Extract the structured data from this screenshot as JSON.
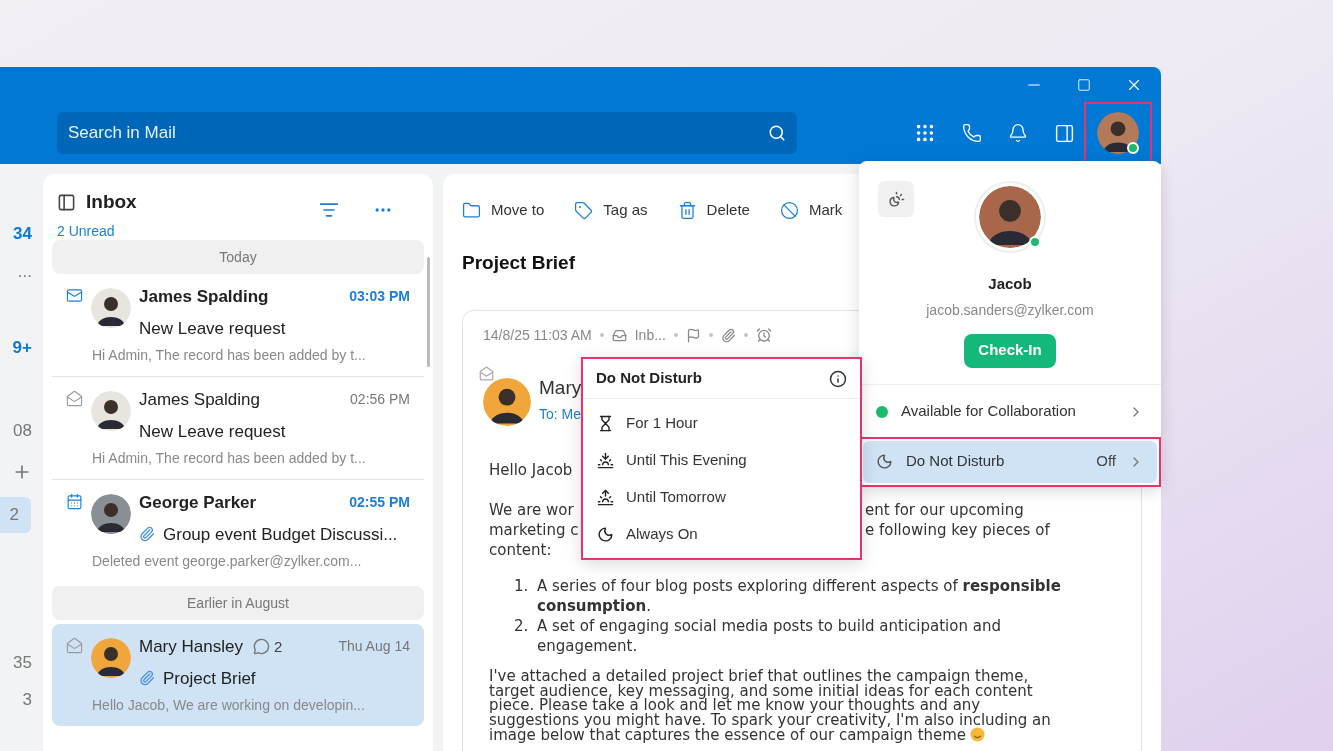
{
  "search": {
    "placeholder": "Search in Mail"
  },
  "avatar_button": {
    "online": true,
    "highlighted": true
  },
  "left_rail": [
    {
      "text": "34",
      "kind": "accent",
      "selected": false
    },
    {
      "text": "...",
      "kind": "plain",
      "selected": false
    },
    {
      "text": "9+",
      "kind": "accent",
      "selected": false
    },
    {
      "text": "08",
      "kind": "plain",
      "selected": false
    },
    {
      "kind": "add",
      "selected": false
    },
    {
      "text": "2",
      "kind": "plain",
      "selected": true
    },
    {
      "text": "35",
      "kind": "plain",
      "selected": false
    },
    {
      "text": "3",
      "kind": "plain",
      "selected": false
    }
  ],
  "inbox": {
    "title": "Inbox",
    "unread": "2 Unread",
    "groups": [
      {
        "label": "Today",
        "messages": [
          {
            "sender": "James Spalding",
            "time": "03:03 PM",
            "subject": "New Leave request",
            "preview": "Hi Admin, The record has been added by t...",
            "unread": true,
            "kind": "mail",
            "attachment": false,
            "selected": false
          },
          {
            "sender": "James Spalding",
            "time": "02:56 PM",
            "subject": "New Leave request",
            "preview": "Hi Admin, The record has been added by t...",
            "unread": false,
            "kind": "mail",
            "attachment": false,
            "selected": false
          },
          {
            "sender": "George Parker",
            "time": "02:55 PM",
            "subject": "Group event Budget Discussi...",
            "preview": "Deleted event george.parker@zylker.com...",
            "unread": true,
            "kind": "event",
            "attachment": true,
            "selected": false
          }
        ]
      },
      {
        "label": "Earlier in August",
        "messages": [
          {
            "sender": "Mary Hansley",
            "comments": "2",
            "time": "Thu Aug 14",
            "subject": "Project Brief",
            "preview": "Hello Jacob, We are working on developin...",
            "unread": false,
            "kind": "mail",
            "attachment": true,
            "selected": true
          }
        ]
      }
    ]
  },
  "toolbar": [
    {
      "label": "Move to"
    },
    {
      "label": "Tag as"
    },
    {
      "label": "Delete"
    },
    {
      "label": "Mark"
    }
  ],
  "message": {
    "subject": "Project Brief",
    "date": "14/8/25 11:03 AM",
    "folder": "Inb...",
    "sender": "Mary",
    "to": "To: Me",
    "greeting": "Hello Jacob",
    "intro_lines": [
      {
        "left": "We are wor",
        "right": "ent for our upcoming"
      },
      {
        "left": "marketing c",
        "right": "e following key pieces of"
      },
      {
        "left": "content:"
      }
    ],
    "list": [
      {
        "number": "1.",
        "text": "A series of four blog posts exploring different aspects of **responsible consumption**."
      },
      {
        "number": "2.",
        "text": "A set of engaging social media posts to build anticipation and engagement."
      }
    ],
    "closing_lines": [
      "I've attached a detailed project brief that outlines the campaign theme,",
      "target audience, key messaging, and some initial ideas for each content",
      "piece. Please take a look and let me know your thoughts and any",
      "suggestions you might have. To spark your creativity, I'm also including an",
      "image below that captures the essence of our campaign theme"
    ]
  },
  "profile": {
    "name": "Jacob",
    "email": "jacob.sanders@zylker.com",
    "check_in": "Check-In",
    "online": true,
    "statuses": [
      {
        "kind": "status",
        "label": "Available for Collaboration",
        "color": "#1fb96e",
        "selected": false,
        "highlighted": false
      },
      {
        "kind": "dnd",
        "label": "Do Not Disturb",
        "value": "Off",
        "selected": true,
        "highlighted": true
      }
    ]
  },
  "dnd_menu": {
    "title": "Do Not Disturb",
    "highlighted": true,
    "options": [
      {
        "label": "For 1 Hour"
      },
      {
        "label": "Until This Evening"
      },
      {
        "label": "Until Tomorrow"
      },
      {
        "label": "Always On"
      }
    ]
  }
}
